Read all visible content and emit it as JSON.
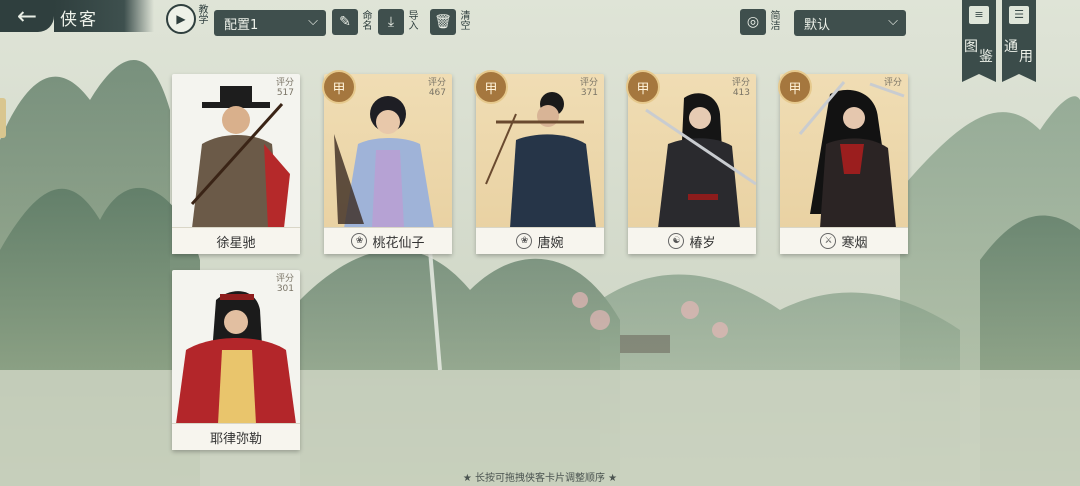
{
  "header": {
    "title": "侠客",
    "tutorial_label": "教学",
    "config_select": "配置1",
    "rename_label": "命名",
    "import_label": "导入",
    "clear_label": "清空",
    "simple_label": "简洁",
    "sort_select": "默认"
  },
  "side_buttons": [
    {
      "label_1": "图",
      "label_2": "鉴"
    },
    {
      "label_1": "通",
      "label_2": "用"
    }
  ],
  "cards": [
    {
      "name": "徐星驰",
      "score_label": "评分",
      "score": "517",
      "grade": "",
      "sect_icon": "",
      "theme": "plain"
    },
    {
      "name": "桃花仙子",
      "score_label": "评分",
      "score": "467",
      "grade": "甲",
      "sect_icon": "lotus-icon",
      "theme": "gold"
    },
    {
      "name": "唐婉",
      "score_label": "评分",
      "score": "371",
      "grade": "甲",
      "sect_icon": "lotus-icon",
      "theme": "gold"
    },
    {
      "name": "椿岁",
      "score_label": "评分",
      "score": "413",
      "grade": "甲",
      "sect_icon": "yinyang-icon",
      "theme": "gold"
    },
    {
      "name": "寒烟",
      "score_label": "评分",
      "score": "",
      "grade": "甲",
      "sect_icon": "sword-icon",
      "theme": "gold"
    },
    {
      "name": "耶律弥勒",
      "score_label": "评分",
      "score": "301",
      "grade": "",
      "sect_icon": "",
      "theme": "plain"
    }
  ],
  "footer": {
    "hint": "★ 长按可拖拽侠客卡片调整顺序 ★"
  },
  "colors": {
    "dark_teal": "#3f4f4d",
    "gold": "#a5773e",
    "paper": "#f4f4ef"
  }
}
